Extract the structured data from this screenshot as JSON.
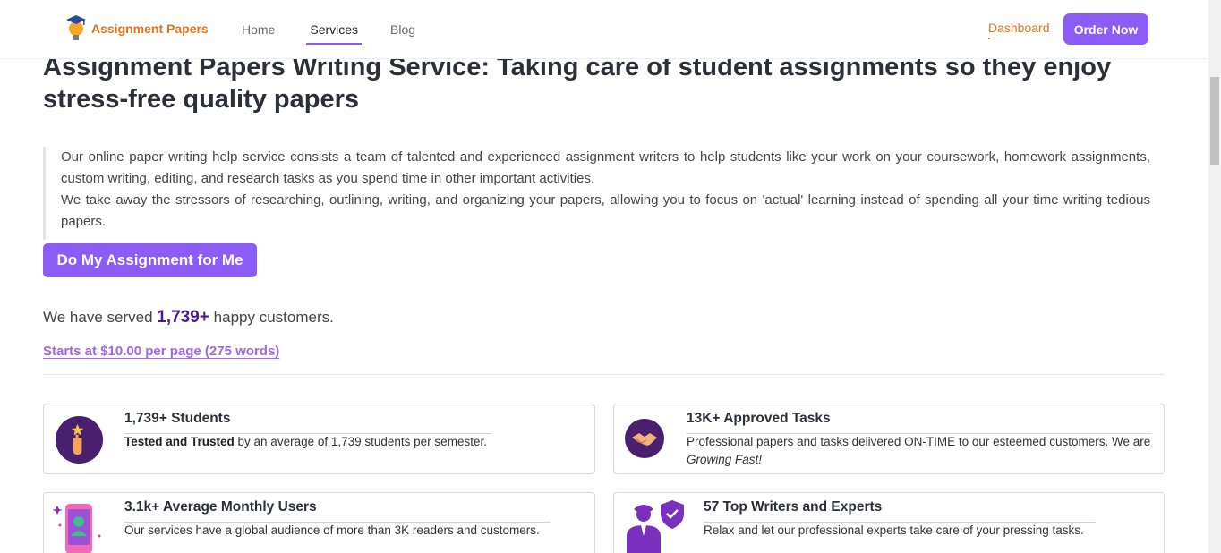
{
  "header": {
    "logo_text": "Assignment Papers",
    "nav": {
      "home": "Home",
      "services": "Services",
      "blog": "Blog"
    },
    "dashboard": "Dashboard",
    "order_now": "Order Now"
  },
  "main": {
    "title": "Assignment Papers Writing Service: Taking care of student assignments so they enjoy stress-free quality papers",
    "intro_p1": "Our online paper writing help service consists a team of talented and experienced assignment writers to help students like your work on your coursework, homework assignments, custom writing, editing, and research tasks as you spend time in other important activities.",
    "intro_p2": "We take away the stressors of researching, outlining, writing, and organizing your papers, allowing you to focus on 'actual' learning instead of spending all your time writing tedious papers.",
    "cta": "Do My Assignment for Me",
    "served_prefix": "We have served",
    "served_count": "1,739+",
    "served_suffix": "happy customers.",
    "price_link": "Starts at $10.00 per page (275 words)"
  },
  "features": [
    {
      "title": "1,739+ Students",
      "text_bold": "Tested and Trusted",
      "text": " by an average of 1,739 students per semester."
    },
    {
      "title": "13K+ Approved Tasks",
      "text": "Professional papers and tasks delivered ON-TIME to our esteemed customers. We are ",
      "text_italic": "Growing Fast!"
    },
    {
      "title": "3.1k+ Average Monthly Users",
      "text": "Our services have a global audience of more than 3K readers and customers."
    },
    {
      "title": "57 Top Writers and Experts",
      "text": "Relax and let our professional experts take care of your pressing tasks."
    }
  ],
  "icons": {
    "logo": "graduation-lightbulb-icon",
    "students": "star-hand-icon",
    "tasks": "handshake-icon",
    "users": "phone-user-icon",
    "writers": "expert-shield-icon"
  },
  "colors": {
    "accent": "#8b5cf6",
    "brand_orange": "#e8701a",
    "dark_purple": "#4a1a8a"
  }
}
